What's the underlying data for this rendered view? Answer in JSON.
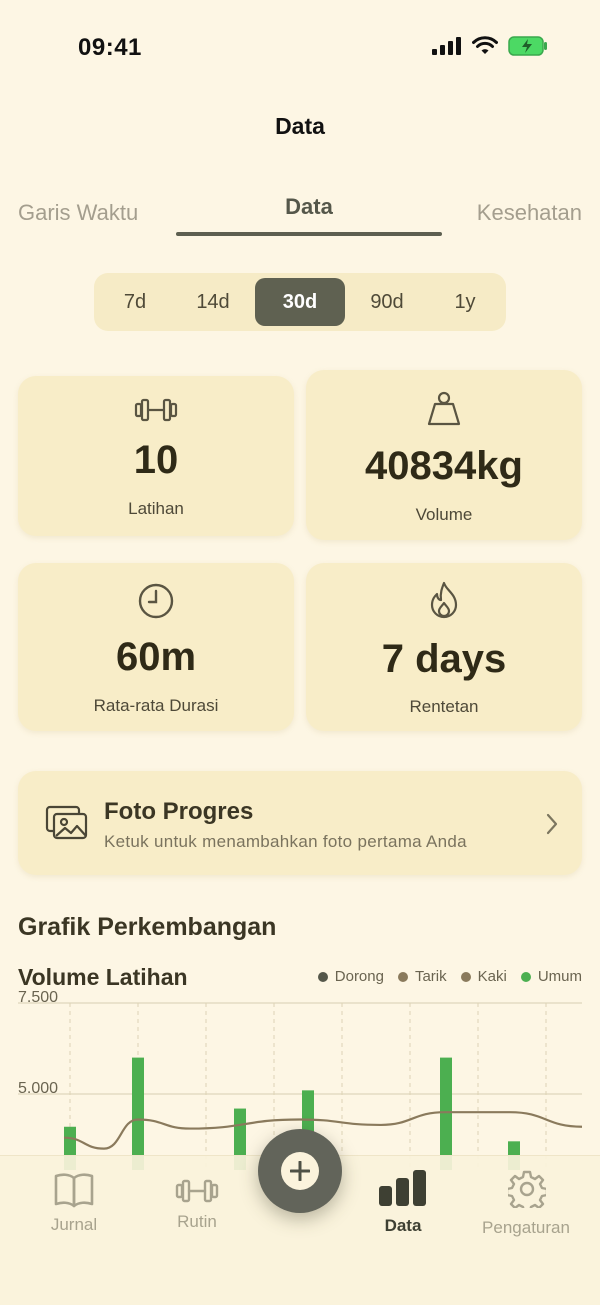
{
  "status": {
    "time": "09:41"
  },
  "header": {
    "title": "Data"
  },
  "tabs": [
    {
      "label": "Garis Waktu"
    },
    {
      "label": "Data"
    },
    {
      "label": "Kesehatan"
    }
  ],
  "ranges": [
    "7d",
    "14d",
    "30d",
    "90d",
    "1y"
  ],
  "selected_range": "30d",
  "stats": [
    {
      "icon": "dumbbell-icon",
      "value": "10",
      "label": "Latihan"
    },
    {
      "icon": "weight-icon",
      "value": "40834kg",
      "label": "Volume"
    },
    {
      "icon": "clock-icon",
      "value": "60m",
      "label": "Rata-rata Durasi"
    },
    {
      "icon": "flame-icon",
      "value": "7 days",
      "label": "Rentetan"
    }
  ],
  "photo_progress": {
    "title": "Foto Progres",
    "subtitle": "Ketuk untuk menambahkan foto pertama Anda"
  },
  "progress_section": {
    "title": "Grafik Perkembangan"
  },
  "colors": {
    "accent": "#5f6151",
    "bar_green": "#4caf50",
    "background": "#fdf6e4"
  },
  "chart_data": {
    "type": "bar",
    "title": "Volume Latihan",
    "legend": [
      {
        "name": "Dorong",
        "color": "#55574a"
      },
      {
        "name": "Tarik",
        "color": "#8a7a5c"
      },
      {
        "name": "Kaki",
        "color": "#8a7a5c"
      },
      {
        "name": "Umum",
        "color": "#4caf50"
      }
    ],
    "y_ticks": [
      "7.500",
      "5.000"
    ],
    "ylim": [
      0,
      7500
    ],
    "bars": [
      4100,
      6000,
      4600,
      5100,
      6000,
      3700
    ],
    "trend": [
      3800,
      3500,
      4300,
      4050,
      4300,
      4150,
      4500,
      4500,
      4100
    ],
    "grid": true
  },
  "tabbar": {
    "items": [
      {
        "label": "Jurnal",
        "icon": "book-icon"
      },
      {
        "label": "Rutin",
        "icon": "dumbbell-icon"
      },
      {
        "label": "Data",
        "icon": "bar-chart-icon"
      },
      {
        "label": "Pengaturan",
        "icon": "gear-icon"
      }
    ],
    "fab_icon": "plus-icon"
  }
}
